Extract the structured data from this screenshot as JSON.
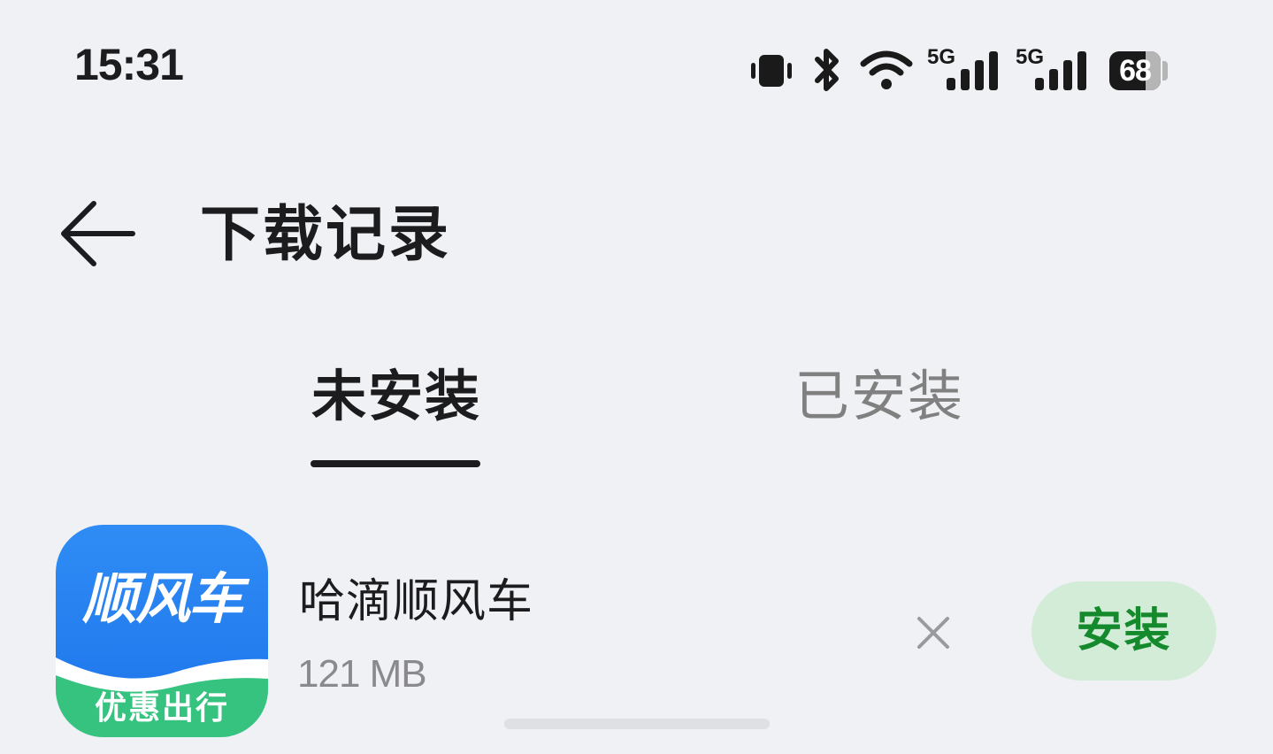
{
  "status_bar": {
    "time": "15:31",
    "battery_level": "68",
    "battery_fraction": 0.68,
    "network_label_1": "5G",
    "network_label_2": "5G",
    "icons": [
      "vibrate-icon",
      "bluetooth-icon",
      "wifi-icon",
      "signal-5g-icon",
      "signal-5g-icon",
      "battery-icon"
    ]
  },
  "header": {
    "back_icon": "arrow-left-icon",
    "title": "下载记录"
  },
  "tabs": [
    {
      "label": "未安装",
      "active": true
    },
    {
      "label": "已安装",
      "active": false
    }
  ],
  "downloads": [
    {
      "name": "哈滴顺风车",
      "size": "121 MB",
      "icon_main_text": "顺风车",
      "icon_sub_text": "优惠出行",
      "install_label": "安装",
      "delete_icon": "close-icon"
    }
  ],
  "colors": {
    "background": "#eff1f4",
    "text_primary": "#1c1c1e",
    "text_secondary": "#8a8a8e",
    "install_button_bg": "#d3ecd8",
    "install_button_text": "#148a2c",
    "app_icon_blue": "#1d74ea",
    "app_icon_green": "#36c37f"
  }
}
